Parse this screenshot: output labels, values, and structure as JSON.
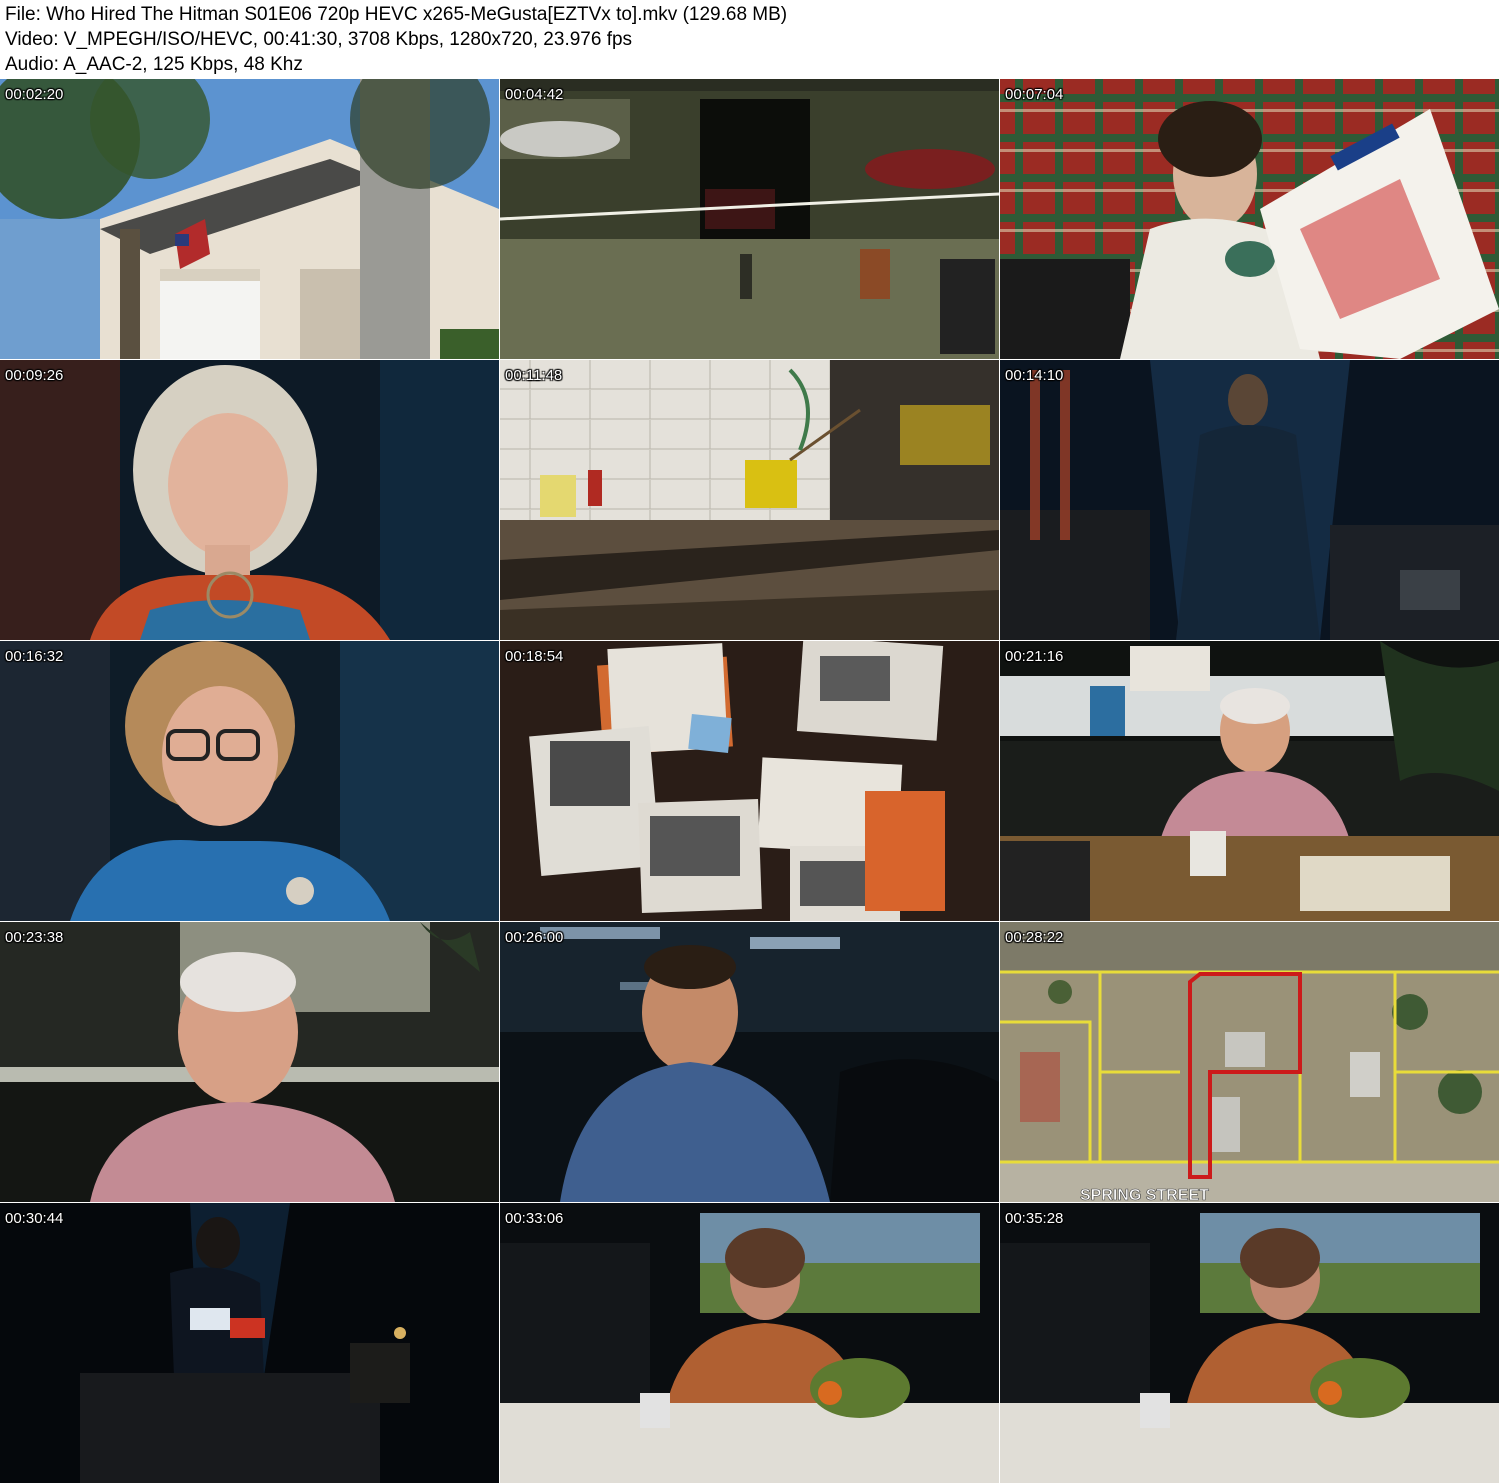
{
  "header": {
    "file_line": "File: Who Hired The Hitman S01E06 720p HEVC x265-MeGusta[EZTVx to].mkv (129.68 MB)",
    "video_line": "Video: V_MPEGH/ISO/HEVC, 00:41:30, 3708 Kbps, 1280x720, 23.976 fps",
    "audio_line": "Audio: A_AAC-2, 125 Kbps, 48 Khz"
  },
  "thumbnails": [
    {
      "timestamp": "00:02:20",
      "scene": "house-with-flag"
    },
    {
      "timestamp": "00:04:42",
      "scene": "auto-garage"
    },
    {
      "timestamp": "00:07:04",
      "scene": "teen-on-couch-photo"
    },
    {
      "timestamp": "00:09:26",
      "scene": "woman-interview-blonde"
    },
    {
      "timestamp": "00:11:48",
      "scene": "wall-with-mop-bucket"
    },
    {
      "timestamp": "00:14:10",
      "scene": "man-in-spotlight"
    },
    {
      "timestamp": "00:16:32",
      "scene": "woman-with-glasses"
    },
    {
      "timestamp": "00:18:54",
      "scene": "evidence-board"
    },
    {
      "timestamp": "00:21:16",
      "scene": "man-at-desk"
    },
    {
      "timestamp": "00:23:38",
      "scene": "man-closeup"
    },
    {
      "timestamp": "00:26:00",
      "scene": "man-plaid-shirt"
    },
    {
      "timestamp": "00:28:22",
      "scene": "aerial-map",
      "map_label": "SPRING STREET"
    },
    {
      "timestamp": "00:30:44",
      "scene": "person-reading"
    },
    {
      "timestamp": "00:33:06",
      "scene": "woman-at-table"
    },
    {
      "timestamp": "00:35:28",
      "scene": "woman-at-table-2"
    }
  ]
}
